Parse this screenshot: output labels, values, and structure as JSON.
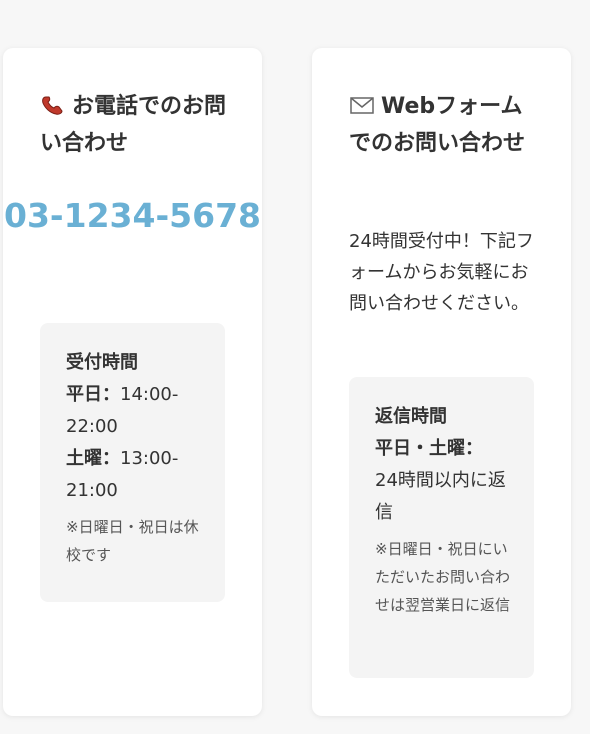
{
  "phone_card": {
    "icon": "phone-icon",
    "title": "お電話でのお問い合わせ",
    "number": "03-1234-5678",
    "hours_box": {
      "heading": "受付時間",
      "weekday_label": "平日：",
      "weekday_hours": "14:00-22:00",
      "saturday_label": "土曜：",
      "saturday_hours": "13:00-21:00",
      "note": "※日曜日・祝日は休校です"
    }
  },
  "web_card": {
    "icon": "mail-icon",
    "title": "Webフォームでのお問い合わせ",
    "description": "24時間受付中！下記フォームからお気軽にお問い合わせください。",
    "reply_box": {
      "heading": "返信時間",
      "days_label": "平日・土曜：",
      "reply_time": "24時間以内に返信",
      "note": "※日曜日・祝日にいただいたお問い合わせは翌営業日に返信"
    }
  },
  "colors": {
    "accent_phone": "#6ab0d4",
    "card_bg": "#ffffff",
    "box_bg": "#f4f4f4"
  }
}
